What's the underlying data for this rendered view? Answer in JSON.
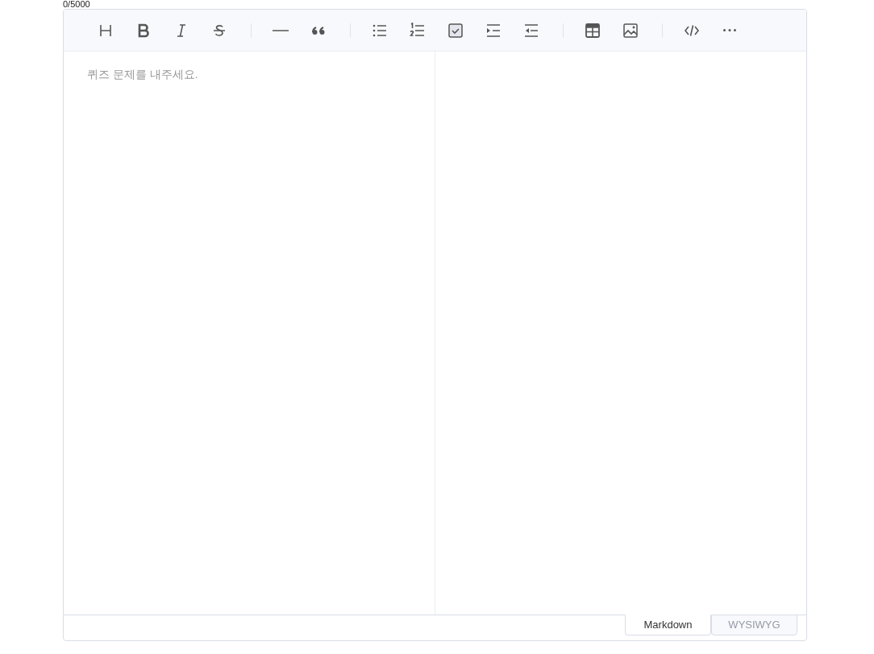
{
  "counter": "0/5000",
  "editor": {
    "placeholder": "퀴즈 문제를 내주세요."
  },
  "mode_tabs": [
    {
      "label": "Markdown",
      "selected": true
    },
    {
      "label": "WYSIWYG",
      "selected": false
    }
  ]
}
